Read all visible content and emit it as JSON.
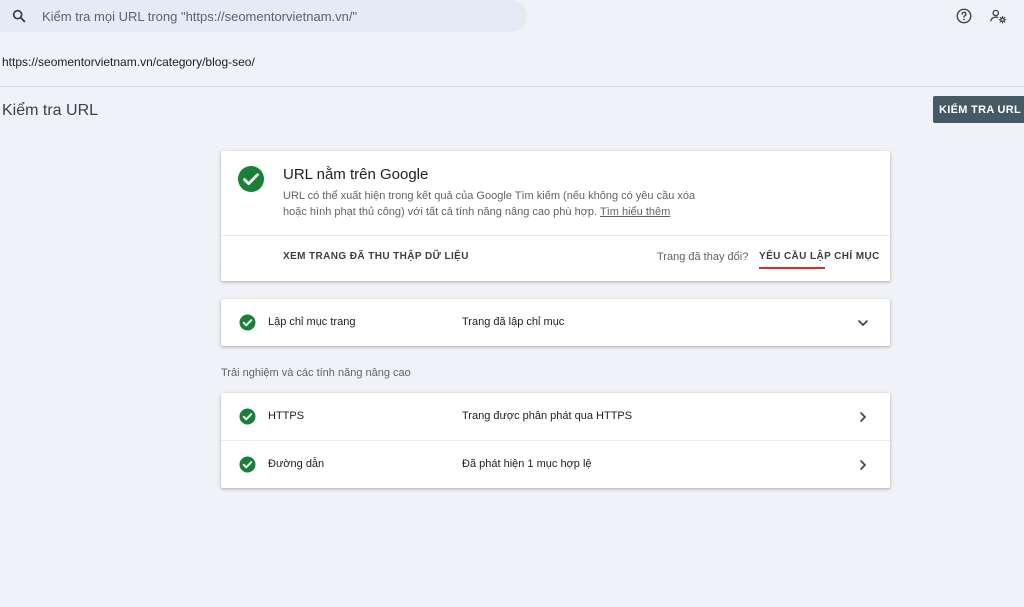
{
  "search": {
    "placeholder": "Kiểm tra mọi URL trong \"https://seomentorvietnam.vn/\""
  },
  "url": "https://seomentorvietnam.vn/category/blog-seo/",
  "page_title": "Kiểm tra URL",
  "test_live_label": "KIỂM TRA URL ĐANG",
  "status": {
    "title": "URL nằm trên Google",
    "desc_line1": "URL có thể xuất hiện trong kết quả của Google Tìm kiếm (nếu không có yêu cầu xóa",
    "desc_line2": "hoặc hình phạt thủ công) với tất cả tính năng nâng cao phù hợp. ",
    "learn_more": "Tìm hiểu thêm",
    "crawled_label": "XEM TRANG ĐÃ THU THẬP DỮ LIỆU",
    "changed_label": "Trang đã thay đổi?",
    "request_label": "YÊU CẦU LẬP CHỈ MỤC"
  },
  "indexing": {
    "name": "Lập chỉ mục trang",
    "value": "Trang đã lập chỉ mục"
  },
  "enhancements_label": "Trải nghiệm và các tính năng nâng cao",
  "enhancements": [
    {
      "name": "HTTPS",
      "value": "Trang được phân phát qua HTTPS"
    },
    {
      "name": "Đường dẫn",
      "value": "Đã phát hiện 1 mục hợp lệ"
    }
  ],
  "colors": {
    "success": "#188038",
    "accent_underline": "#d93025",
    "button_bg": "#455a64"
  }
}
